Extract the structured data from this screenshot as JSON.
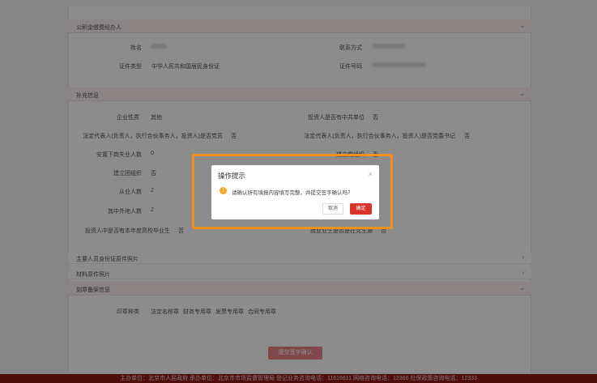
{
  "section1": {
    "title": "公积金缴费经办人",
    "fields": [
      {
        "label": "姓名",
        "value": ""
      },
      {
        "label": "联系方式",
        "value": ""
      },
      {
        "label": "证件类型",
        "value": "中华人民共和国居民身份证"
      },
      {
        "label": "证件号码",
        "value": ""
      }
    ]
  },
  "section2": {
    "title": "补充信息",
    "fields": [
      {
        "label": "企业性质",
        "value": "其他"
      },
      {
        "label": "投资人是否有中共单位",
        "value": "否"
      },
      {
        "label": "法定代表人(负责人，执行合伙事务人，投资人)是否党员",
        "value": "否"
      },
      {
        "label": "法定代表人(负责人，执行合伙事务人，投资人)是否党委书记",
        "value": "否"
      },
      {
        "label": "安置下岗失业人数",
        "value": "0"
      },
      {
        "label": "建立党组织",
        "value": "否"
      },
      {
        "label": "建立团组织",
        "value": "否"
      },
      {
        "label": "从业人数",
        "value": "2"
      },
      {
        "label": "其中外地人数",
        "value": "2"
      },
      {
        "label": "投资人中是否有本年度高校毕业生",
        "value": "否"
      },
      {
        "label": "就业业生是否是在党生源",
        "value": "否"
      }
    ]
  },
  "collapsed_rows": [
    "主要人员身份证原件照片",
    "材料原件照片"
  ],
  "section3": {
    "title": "刻章备案信息",
    "seal_label": "印章种类",
    "seal_types": [
      "法定名称章",
      "财务专用章",
      "发票专用章",
      "合同专用章"
    ]
  },
  "submit_label": "提交签字确认",
  "footer_text": "主办单位：北京市人民政府   承办单位：北京市市场监督管理局   登记业务咨询电话：11616611   网络咨询电话：12366   社保政策咨询电话：12333",
  "dialog": {
    "title": "操作提示",
    "message": "请确认所有填报内容填写完整，并提交签字确认吗？",
    "cancel_label": "取消",
    "ok_label": "确定",
    "warn_symbol": "!",
    "close_symbol": "×"
  },
  "colors": {
    "accent": "#d9342b",
    "highlight": "#f0911f",
    "footer": "#8e1b1b"
  }
}
